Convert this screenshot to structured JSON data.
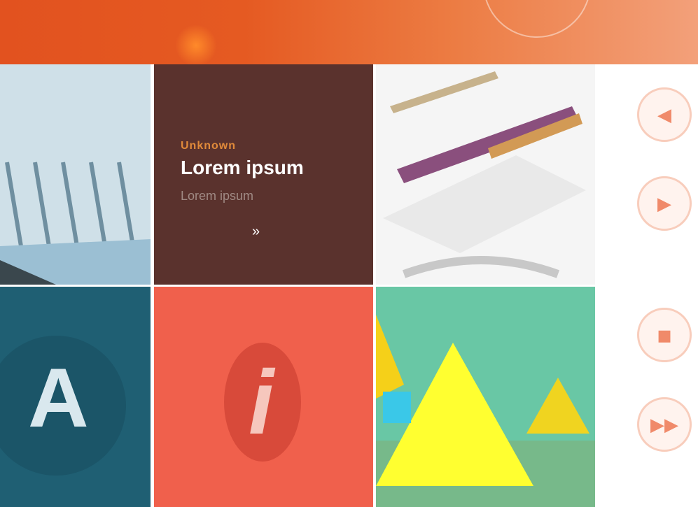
{
  "header": {
    "colors": {
      "start": "#e2521f",
      "end": "#f3a07a"
    }
  },
  "tiles": [
    {
      "id": "photo-building",
      "kind": "image"
    },
    {
      "id": "brown-card",
      "kind": "card",
      "kicker": "Unknown",
      "title": "Lorem ipsum",
      "subtitle": "Lorem ipsum",
      "arrow": "»"
    },
    {
      "id": "pencils",
      "kind": "image"
    },
    {
      "id": "letter-a",
      "kind": "icon",
      "glyph": "A"
    },
    {
      "id": "info",
      "kind": "icon",
      "glyph": "i"
    },
    {
      "id": "landscape",
      "kind": "image"
    }
  ],
  "sidebar": {
    "buttons": [
      {
        "name": "prev-button",
        "glyph": "◀"
      },
      {
        "name": "play-button",
        "glyph": "▶"
      },
      {
        "name": "stop-button",
        "glyph": "◼"
      },
      {
        "name": "next-button",
        "glyph": "▶▶"
      }
    ]
  },
  "colors": {
    "brown": "#5a322d",
    "teal": "#1f5f73",
    "coral": "#f0604c"
  }
}
